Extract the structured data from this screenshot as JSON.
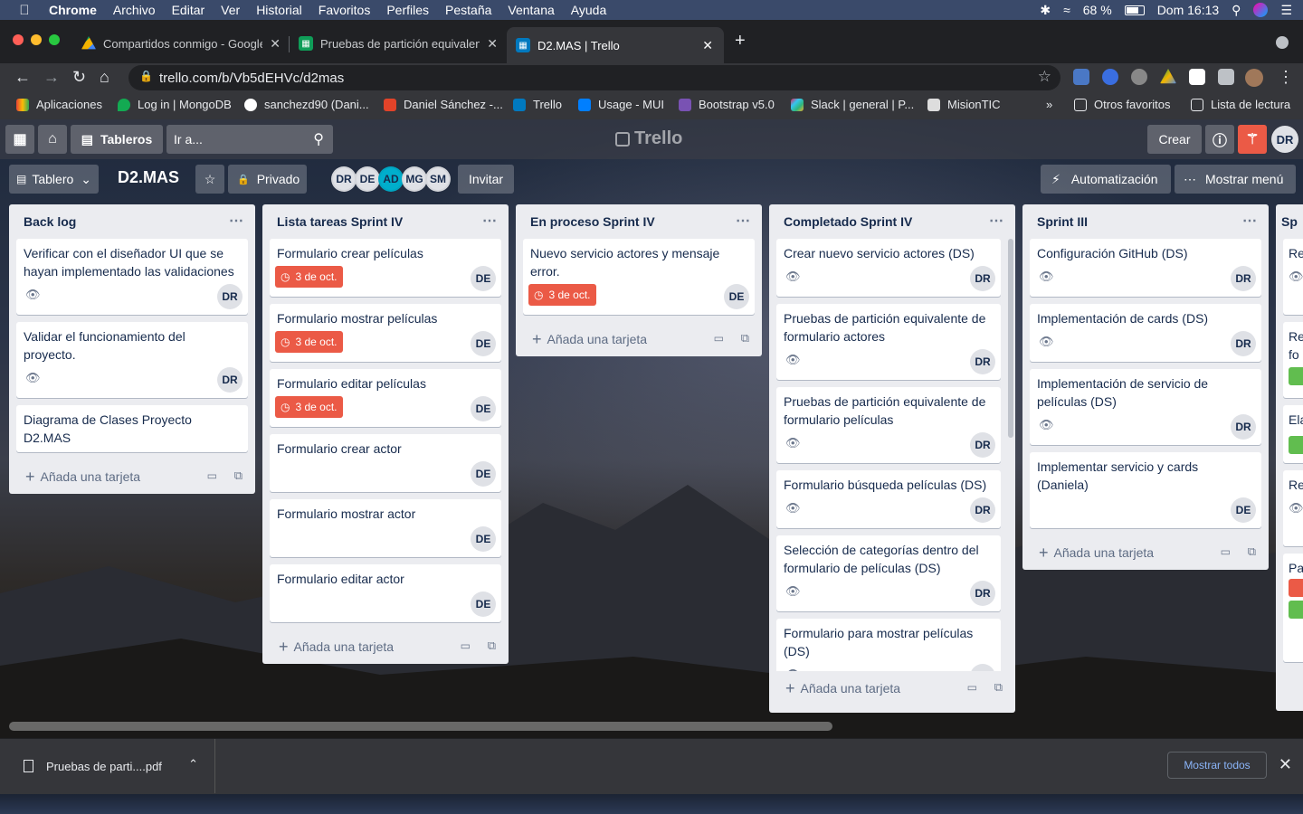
{
  "menubar": {
    "items": [
      "Chrome",
      "Archivo",
      "Editar",
      "Ver",
      "Historial",
      "Favoritos",
      "Perfiles",
      "Pestaña",
      "Ventana",
      "Ayuda"
    ],
    "battery": "68 %",
    "clock": "Dom 16:13"
  },
  "tabs": [
    {
      "title": "Compartidos conmigo - Google"
    },
    {
      "title": "Pruebas de partición equivalen"
    },
    {
      "title": "D2.MAS | Trello"
    }
  ],
  "omnibox": {
    "url": "trello.com/b/Vb5dEHVc/d2mas"
  },
  "bookmarks": [
    {
      "label": "Aplicaciones"
    },
    {
      "label": "Log in | MongoDB"
    },
    {
      "label": "sanchezd90 (Dani..."
    },
    {
      "label": "Daniel Sánchez -..."
    },
    {
      "label": "Trello"
    },
    {
      "label": "Usage - MUI"
    },
    {
      "label": "Bootstrap v5.0"
    },
    {
      "label": "Slack | general | P..."
    },
    {
      "label": "MisionTIC"
    },
    {
      "label": "Otros favoritos"
    },
    {
      "label": "Lista de lectura"
    }
  ],
  "trello_nav": {
    "boards_label": "Tableros",
    "search_placeholder": "Ir a...",
    "logo": "Trello",
    "create_label": "Crear",
    "user_initials": "DR"
  },
  "board": {
    "view_label": "Tablero",
    "name": "D2.MAS",
    "visibility": "Privado",
    "members": [
      "DR",
      "DE",
      "AD",
      "MG",
      "SM"
    ],
    "invite_label": "Invitar",
    "automation_label": "Automatización",
    "menu_label": "Mostrar menú"
  },
  "add_card_label": "Añada una tarjeta",
  "lists": [
    {
      "title": "Back log",
      "cards": [
        {
          "title": "Verificar con el diseñador UI que se hayan implementado las validaciones",
          "avatar": "DR"
        },
        {
          "title": "Validar el funcionamiento del proyecto.",
          "avatar": "DR"
        },
        {
          "title": "Diagrama de Clases Proyecto D2.MAS"
        }
      ]
    },
    {
      "title": "Lista tareas Sprint IV",
      "cards": [
        {
          "title": "Formulario crear películas",
          "due": "3 de oct.",
          "avatar": "DE"
        },
        {
          "title": "Formulario mostrar películas",
          "due": "3 de oct.",
          "avatar": "DE"
        },
        {
          "title": "Formulario editar películas",
          "due": "3 de oct.",
          "avatar": "DE"
        },
        {
          "title": "Formulario crear actor",
          "avatar": "DE"
        },
        {
          "title": "Formulario mostrar actor",
          "avatar": "DE"
        },
        {
          "title": "Formulario editar actor",
          "avatar": "DE"
        }
      ]
    },
    {
      "title": "En proceso Sprint IV",
      "cards": [
        {
          "title": "Nuevo servicio actores y mensaje error.",
          "due": "3 de oct.",
          "avatar": "DE"
        }
      ]
    },
    {
      "title": "Completado Sprint IV",
      "cards": [
        {
          "title": "Crear nuevo servicio actores (DS)",
          "avatar": "DR"
        },
        {
          "title": "Pruebas de partición equivalente de formulario actores",
          "avatar": "DR"
        },
        {
          "title": "Pruebas de partición equivalente de formulario películas",
          "avatar": "DR"
        },
        {
          "title": "Formulario búsqueda películas (DS)",
          "avatar": "DR"
        },
        {
          "title": "Selección de categorías dentro del formulario de películas (DS)",
          "avatar": "DR"
        },
        {
          "title": "Formulario para mostrar películas (DS)",
          "avatar": "DR"
        }
      ]
    },
    {
      "title": "Sprint III",
      "cards": [
        {
          "title": "Configuración GitHub (DS)",
          "avatar": "DR"
        },
        {
          "title": "Implementación de cards (DS)",
          "avatar": "DR"
        },
        {
          "title": "Implementación de servicio de películas (DS)",
          "avatar": "DR"
        },
        {
          "title": "Implementar servicio y cards (Daniela)",
          "avatar": "DE"
        }
      ]
    },
    {
      "title": "Sp",
      "cards": [
        {
          "title": "Re"
        },
        {
          "title": "Re fo"
        },
        {
          "title": "Ela"
        },
        {
          "title": "Re"
        },
        {
          "title": "Pa"
        }
      ]
    }
  ],
  "download": {
    "filename": "Pruebas de parti....pdf",
    "show_all": "Mostrar todos"
  },
  "colors": {
    "due": "#eb5a46",
    "list_bg": "#ebecf0",
    "notification": "#eb5a46",
    "member_active": "#00aecc"
  }
}
